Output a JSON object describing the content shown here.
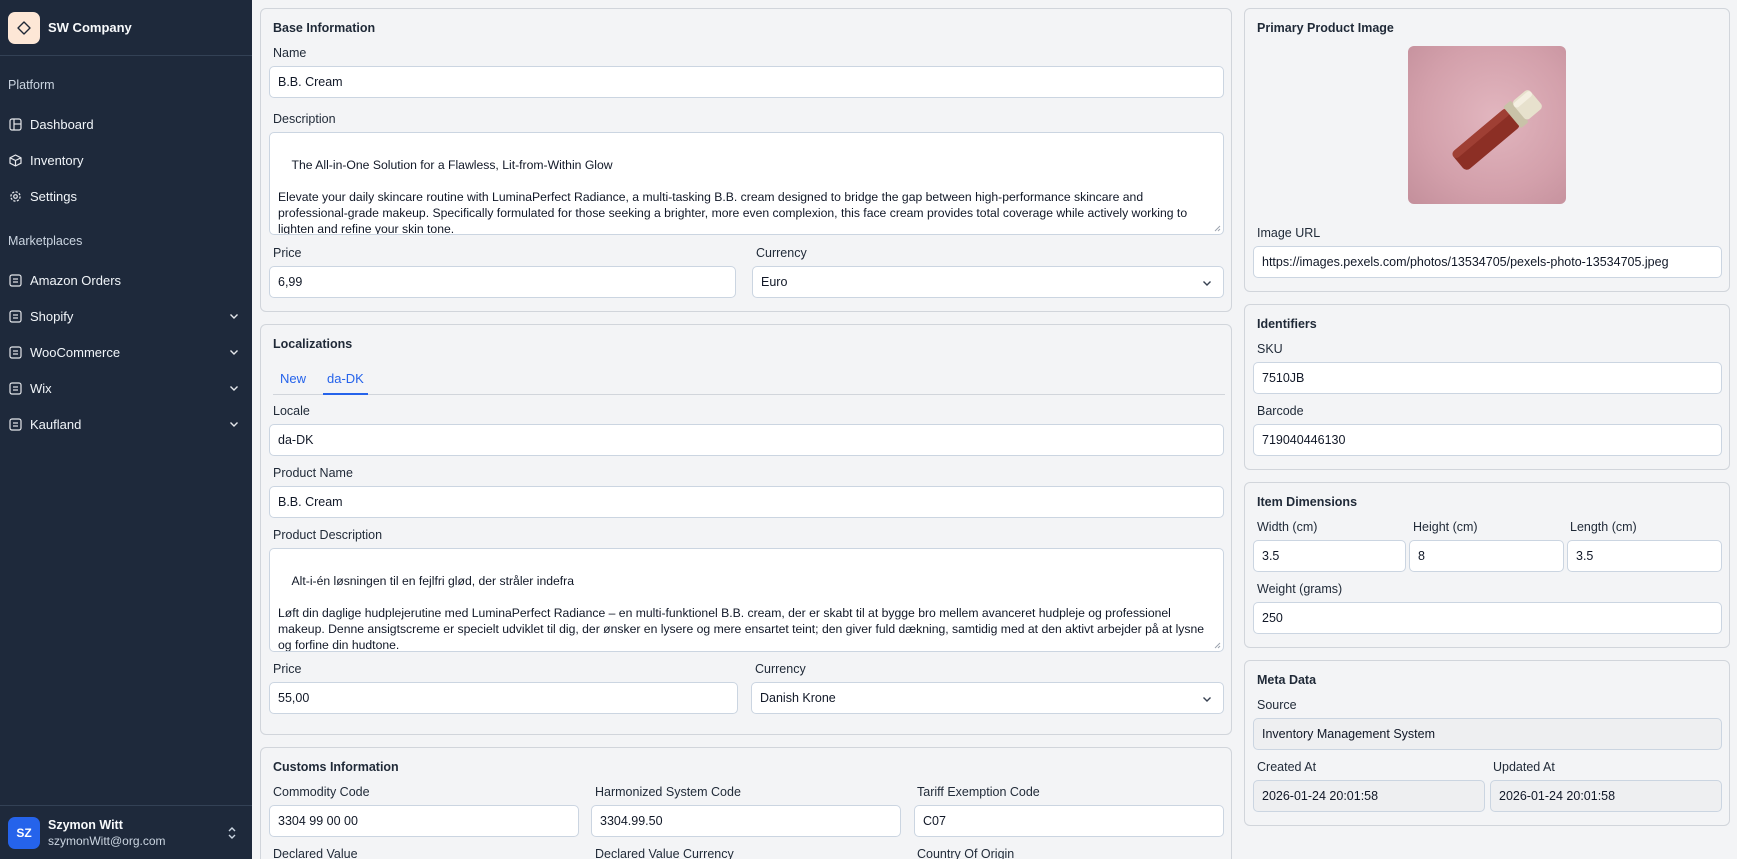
{
  "sidebar": {
    "company": "SW Company",
    "section_platform": "Platform",
    "platform_items": [
      {
        "label": "Dashboard"
      },
      {
        "label": "Inventory"
      },
      {
        "label": "Settings"
      }
    ],
    "section_marketplaces": "Marketplaces",
    "marketplace_items": [
      {
        "label": "Amazon Orders"
      },
      {
        "label": "Shopify"
      },
      {
        "label": "WooCommerce"
      },
      {
        "label": "Wix"
      },
      {
        "label": "Kaufland"
      }
    ],
    "user": {
      "initials": "SZ",
      "name": "Szymon Witt",
      "email": "szymonWitt@org.com"
    }
  },
  "base": {
    "title": "Base Information",
    "name_label": "Name",
    "name": "B.B. Cream",
    "description_label": "Description",
    "description": "The All-in-One Solution for a Flawless, Lit-from-Within Glow\n\nElevate your daily skincare routine with LuminaPerfect Radiance, a multi-tasking B.B. cream designed to bridge the gap between high-performance skincare and professional-grade makeup. Specifically formulated for those seeking a brighter, more even complexion, this face cream provides total coverage while actively working to lighten and refine your skin tone.",
    "price_label": "Price",
    "price": "6,99",
    "currency_label": "Currency",
    "currency": "Euro"
  },
  "localizations": {
    "title": "Localizations",
    "tabs": [
      {
        "label": "New"
      },
      {
        "label": "da-DK"
      }
    ],
    "locale_label": "Locale",
    "locale": "da-DK",
    "product_name_label": "Product Name",
    "product_name": "B.B. Cream",
    "product_description_label": "Product Description",
    "product_description": "Alt-i-én løsningen til en fejlfri glød, der stråler indefra\n\nLøft din daglige hudplejerutine med LuminaPerfect Radiance – en multi-funktionel B.B. cream, der er skabt til at bygge bro mellem avanceret hudpleje og professionel makeup. Denne ansigtscreme er specielt udviklet til dig, der ønsker en lysere og mere ensartet teint; den giver fuld dækning, samtidig med at den aktivt arbejder på at lysne og forfine din hudtone.",
    "price_label": "Price",
    "price": "55,00",
    "currency_label": "Currency",
    "currency": "Danish Krone"
  },
  "customs": {
    "title": "Customs Information",
    "commodity_code_label": "Commodity Code",
    "commodity_code": "3304 99 00 00",
    "hs_code_label": "Harmonized System Code",
    "hs_code": "3304.99.50",
    "tariff_label": "Tariff Exemption Code",
    "tariff": "C07",
    "declared_value_label": "Declared Value",
    "declared_currency_label": "Declared Value Currency",
    "country_label": "Country Of Origin"
  },
  "image": {
    "title": "Primary Product Image",
    "url_label": "Image URL",
    "url": "https://images.pexels.com/photos/13534705/pexels-photo-13534705.jpeg"
  },
  "identifiers": {
    "title": "Identifiers",
    "sku_label": "SKU",
    "sku": "7510JB",
    "barcode_label": "Barcode",
    "barcode": "719040446130"
  },
  "dimensions": {
    "title": "Item Dimensions",
    "width_label": "Width (cm)",
    "width": "3.5",
    "height_label": "Height (cm)",
    "height": "8",
    "length_label": "Length (cm)",
    "length": "3.5",
    "weight_label": "Weight (grams)",
    "weight": "250"
  },
  "meta": {
    "title": "Meta Data",
    "source_label": "Source",
    "source": "Inventory Management System",
    "created_label": "Created At",
    "created": "2026-01-24 20:01:58",
    "updated_label": "Updated At",
    "updated": "2026-01-24 20:01:58"
  }
}
